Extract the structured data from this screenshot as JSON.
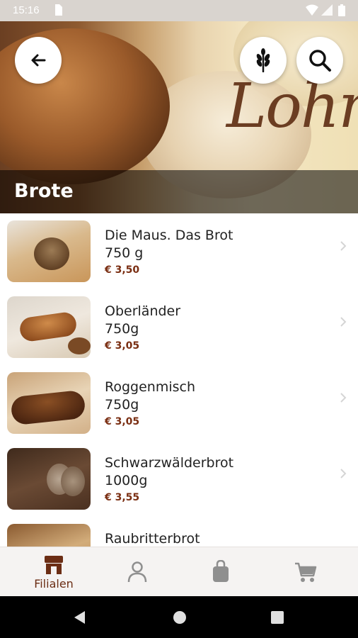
{
  "status_bar": {
    "time": "15:16"
  },
  "header": {
    "title": "Brote",
    "brand_text": "Lohn"
  },
  "products": [
    {
      "name": "Die Maus. Das Brot",
      "weight": "750 g",
      "price": "€ 3,50"
    },
    {
      "name": "Oberländer",
      "weight": "750g",
      "price": "€ 3,05"
    },
    {
      "name": "Roggenmisch",
      "weight": "750g",
      "price": "€ 3,05"
    },
    {
      "name": "Schwarzwälderbrot",
      "weight": "1000g",
      "price": "€ 3,55"
    },
    {
      "name": "Raubritterbrot"
    }
  ],
  "bottom_nav": {
    "items": [
      {
        "label": "Filialen",
        "icon": "store-icon",
        "active": true
      },
      {
        "icon": "person-icon"
      },
      {
        "icon": "shopping-bag-icon"
      },
      {
        "icon": "cart-icon"
      }
    ]
  },
  "colors": {
    "accent": "#6b2d14",
    "price": "#7a2e12",
    "inactive_icon": "#8f8f8f"
  }
}
